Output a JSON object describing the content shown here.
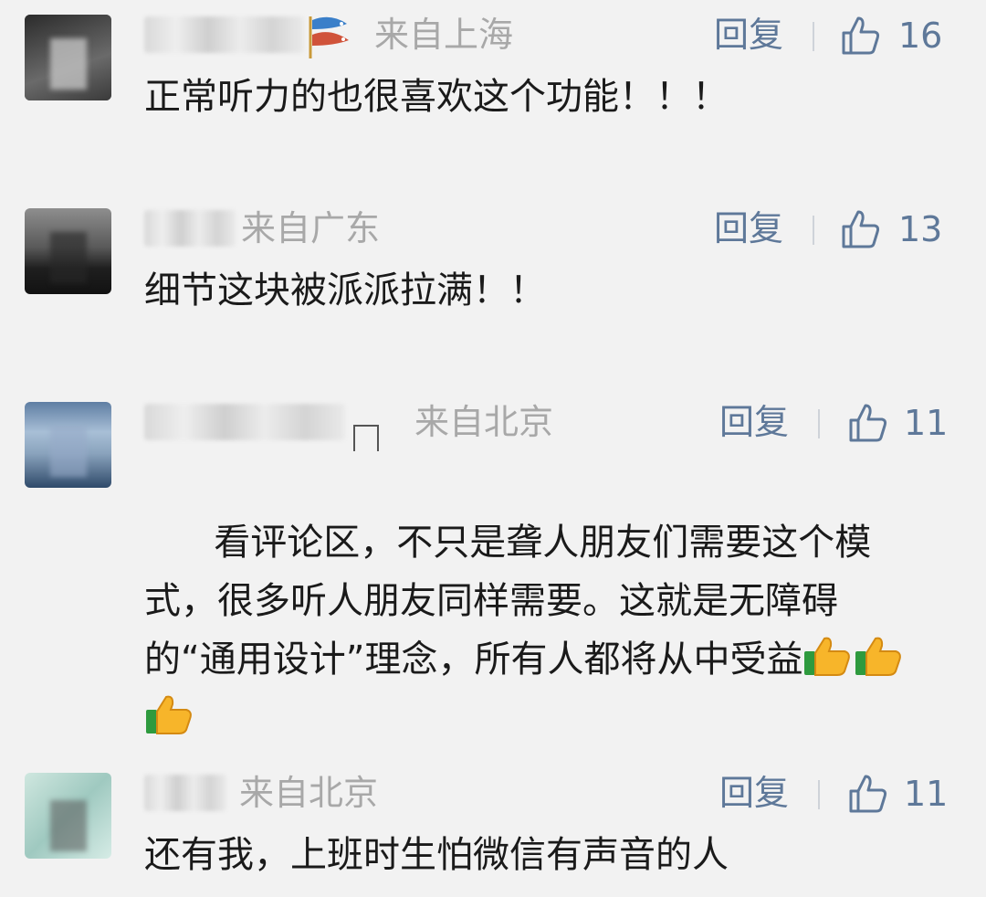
{
  "comments": [
    {
      "location": "来自上海",
      "reply_label": "回复",
      "likes": "16",
      "text": "正常听力的也很喜欢这个功能！！！",
      "avatar_color": "#4a4a4a"
    },
    {
      "location": "来自广东",
      "reply_label": "回复",
      "likes": "13",
      "text": "细节这块被派派拉满！！",
      "avatar_color": "#3b3b3b"
    },
    {
      "location": "来自北京",
      "reply_label": "回复",
      "likes": "11",
      "text": "看评论区，不只是聋人朋友们需要这个模式，很多听人朋友同样需要。这就是无障碍的“通用设计”理念，所有人都将从中受益",
      "avatar_color": "#7f97b3"
    },
    {
      "location": "来自北京",
      "reply_label": "回复",
      "likes": "11",
      "text": "还有我，上班时生怕微信有声音的人",
      "avatar_color": "#9fc9c0"
    }
  ],
  "colors": {
    "background": "#f2f2f2",
    "link": "#5e7899",
    "meta": "#a8a8a8",
    "text": "#1a1a1a"
  }
}
